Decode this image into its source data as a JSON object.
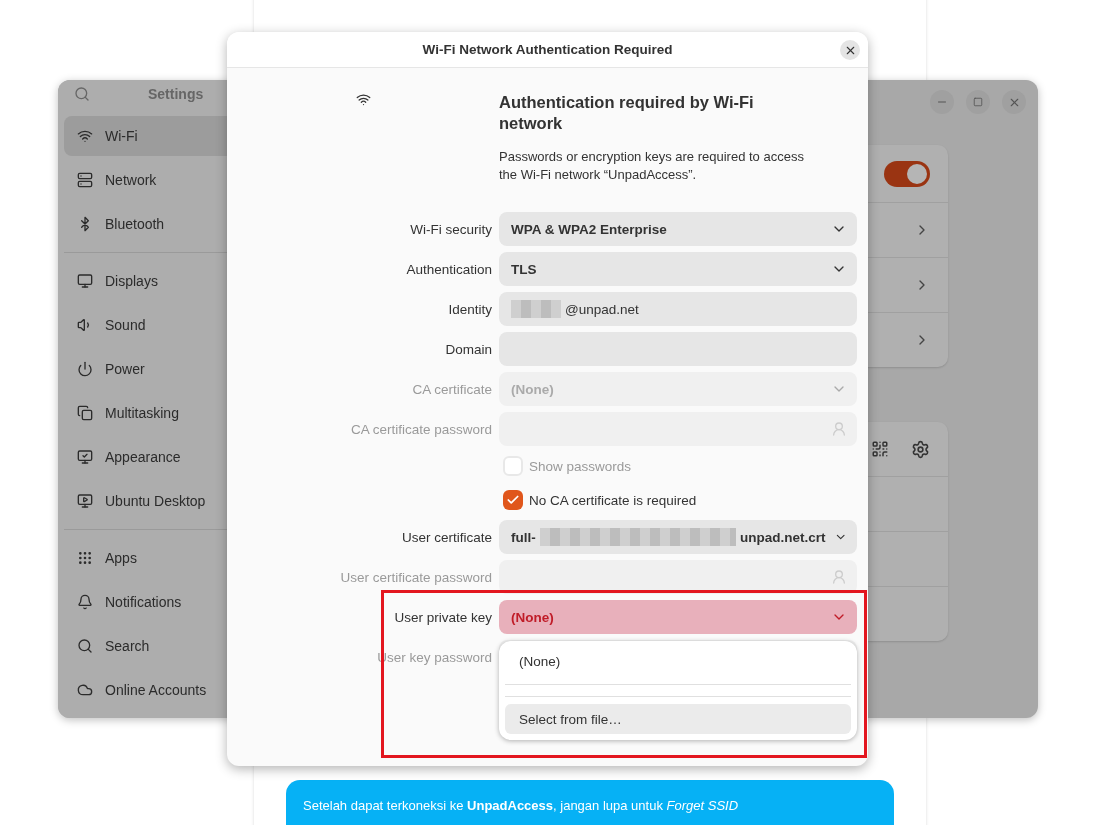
{
  "page": {
    "banner": {
      "text": "Setelah dapat terkoneksi ke **UnpadAccess**, jangan lupa untuk *Forget SSID*"
    }
  },
  "settings": {
    "title": "Settings",
    "sidebar": {
      "sections": [
        {
          "items": [
            {
              "label": "Wi-Fi",
              "selected": true
            },
            {
              "label": "Network",
              "selected": false
            },
            {
              "label": "Bluetooth",
              "selected": false
            }
          ]
        },
        {
          "items": [
            {
              "label": "Displays",
              "selected": false
            },
            {
              "label": "Sound",
              "selected": false
            },
            {
              "label": "Power",
              "selected": false
            },
            {
              "label": "Multitasking",
              "selected": false
            },
            {
              "label": "Appearance",
              "selected": false
            },
            {
              "label": "Ubuntu Desktop",
              "selected": false
            }
          ]
        },
        {
          "items": [
            {
              "label": "Apps",
              "selected": false
            },
            {
              "label": "Notifications",
              "selected": false
            },
            {
              "label": "Search",
              "selected": false
            },
            {
              "label": "Online Accounts",
              "selected": false
            }
          ]
        }
      ]
    },
    "wifi_switch": {
      "on": true
    }
  },
  "dialog": {
    "title": "Wi-Fi Network Authentication Required",
    "heading": "Authentication required by Wi-Fi network",
    "description": "Passwords or encryption keys are required to access the Wi-Fi network “UnpadAccess”.",
    "fields": [
      {
        "kind": "dropdown",
        "label": "Wi-Fi security",
        "value": "WPA & WPA2 Enterprise",
        "disabled": false
      },
      {
        "kind": "dropdown",
        "label": "Authentication",
        "value": "TLS",
        "disabled": false
      },
      {
        "kind": "entry",
        "label": "Identity",
        "value": "@unpad.net",
        "redacted_prefix": true,
        "disabled": false
      },
      {
        "kind": "entry",
        "label": "Domain",
        "disabled": false
      },
      {
        "kind": "dropdown",
        "label": "CA certificate",
        "value": "(None)",
        "disabled": true
      },
      {
        "kind": "password",
        "label": "CA certificate password",
        "disabled": true
      },
      {
        "kind": "checkbox",
        "text": "Show passwords",
        "checked": false,
        "disabled": true
      },
      {
        "kind": "checkbox",
        "text": "No CA certificate is required",
        "checked": true,
        "disabled": false
      },
      {
        "kind": "dropdown",
        "label": "User certificate",
        "value": "full-",
        "value_end": "unpad.net.crt",
        "disabled": false
      },
      {
        "kind": "password",
        "label": "User certificate password",
        "disabled": true
      },
      {
        "kind": "dropdown",
        "label": "User private key",
        "value": "(None)",
        "disabled": false,
        "error": true
      },
      {
        "kind": "password",
        "label": "User key password",
        "disabled": true
      }
    ],
    "popover": {
      "options": [
        {
          "label": "(None)",
          "highlighted": false
        },
        {
          "label": "Select from file…",
          "highlighted": true
        }
      ]
    }
  }
}
